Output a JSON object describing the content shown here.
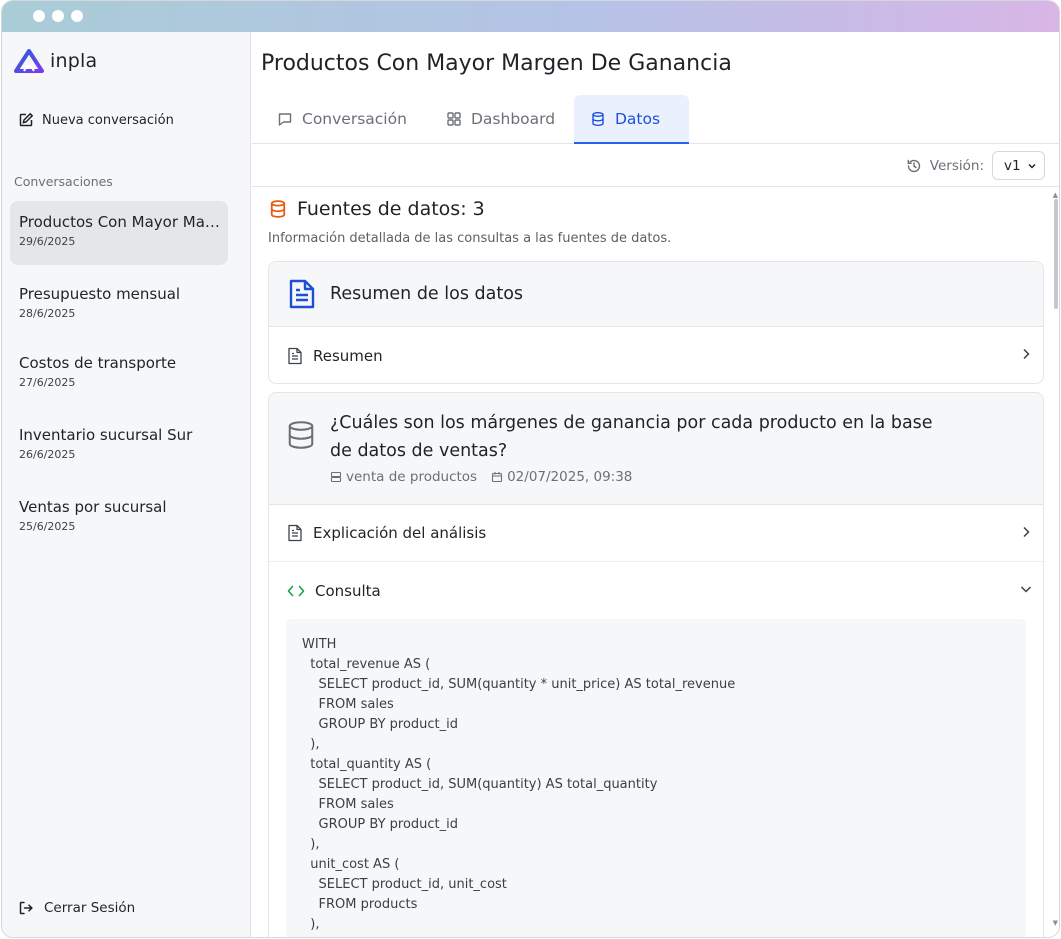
{
  "app": {
    "name": "inpla"
  },
  "sidebar": {
    "new_conversation": "Nueva conversación",
    "conversations_heading": "Conversaciones",
    "conversations": [
      {
        "title": "Productos Con Mayor Margen De Ganancia",
        "date": "29/6/2025",
        "active": true
      },
      {
        "title": "Presupuesto mensual",
        "date": "28/6/2025"
      },
      {
        "title": "Costos de transporte",
        "date": "27/6/2025"
      },
      {
        "title": "Inventario sucursal Sur",
        "date": "26/6/2025"
      },
      {
        "title": "Ventas por sucursal",
        "date": "25/6/2025"
      }
    ],
    "logout": "Cerrar Sesión"
  },
  "main": {
    "title": "Productos Con Mayor Margen De Ganancia",
    "tabs": [
      {
        "label": "Conversación",
        "icon": "message-icon"
      },
      {
        "label": "Dashboard",
        "icon": "grid-icon"
      },
      {
        "label": "Datos",
        "icon": "database-icon",
        "active": true
      }
    ],
    "version": {
      "label": "Versión:",
      "value": "v1"
    }
  },
  "data_view": {
    "sources_title": "Fuentes de datos: 3",
    "sources_subtitle": "Información detallada de las consultas a las fuentes de datos.",
    "summary_card": {
      "title": "Resumen de los datos",
      "rows": [
        {
          "label": "Resumen"
        }
      ]
    },
    "query_card": {
      "question": "¿Cuáles son los márgenes de ganancia por cada producto en la base de datos de ventas?",
      "source": "venta de productos",
      "datetime": "02/07/2025, 09:38",
      "rows": [
        {
          "label": "Explicación del análisis"
        },
        {
          "label": "Consulta"
        }
      ],
      "code": "WITH\n  total_revenue AS (\n    SELECT product_id, SUM(quantity * unit_price) AS total_revenue\n    FROM sales\n    GROUP BY product_id\n  ),\n  total_quantity AS (\n    SELECT product_id, SUM(quantity) AS total_quantity\n    FROM sales\n    GROUP BY product_id\n  ),\n  unit_cost AS (\n    SELECT product_id, unit_cost\n    FROM products\n  ),"
    }
  },
  "colors": {
    "accent": "#2563eb",
    "tab_active_bg": "#eaf1fd",
    "sources_icon": "#ea580c",
    "code_icon": "#16a34a",
    "summary_icon": "#1d4ed8"
  }
}
